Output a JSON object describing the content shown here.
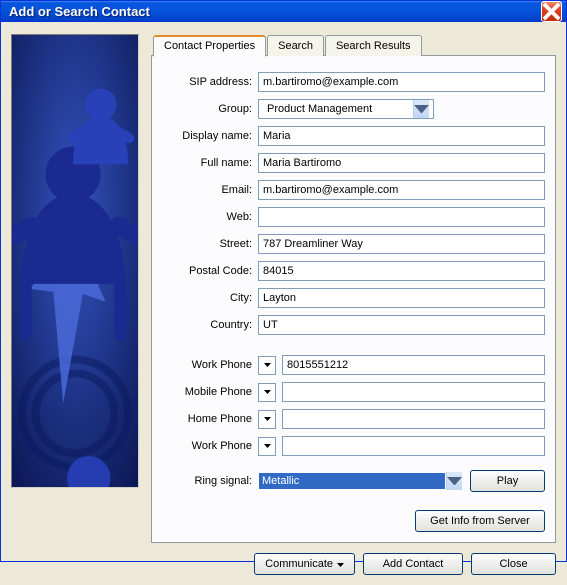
{
  "window": {
    "title": "Add or Search Contact"
  },
  "tabs": {
    "contact_properties": "Contact Properties",
    "search": "Search",
    "search_results": "Search Results"
  },
  "labels": {
    "sip": "SIP address:",
    "group": "Group:",
    "display_name": "Display name:",
    "full_name": "Full name:",
    "email": "Email:",
    "web": "Web:",
    "street": "Street:",
    "postal": "Postal Code:",
    "city": "City:",
    "country": "Country:",
    "work_phone": "Work Phone",
    "mobile_phone": "Mobile Phone",
    "home_phone": "Home Phone",
    "work_phone2": "Work Phone",
    "ring": "Ring signal:"
  },
  "values": {
    "sip": "m.bartiromo@example.com",
    "group": "Product Management",
    "display_name": "Maria",
    "full_name": "Maria Bartiromo",
    "email": "m.bartiromo@example.com",
    "web": "",
    "street": "787 Dreamliner Way",
    "postal": "84015",
    "city": "Layton",
    "country": "UT",
    "work_phone": "8015551212",
    "mobile_phone": "",
    "home_phone": "",
    "work_phone2": "",
    "ring": "Metallic"
  },
  "buttons": {
    "play": "Play",
    "get_info": "Get Info from Server",
    "communicate": "Communicate",
    "add_contact": "Add Contact",
    "close": "Close"
  }
}
